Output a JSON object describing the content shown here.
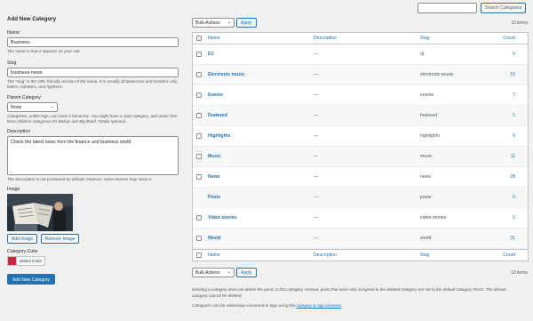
{
  "search": {
    "value": "",
    "button": "Search Categories"
  },
  "form": {
    "title": "Add New Category",
    "name_label": "Name",
    "name_value": "Business",
    "name_desc": "The name is how it appears on your site.",
    "slug_label": "Slug",
    "slug_value": "business-news",
    "slug_desc": "The “slug” is the URL-friendly version of the name. It is usually all lowercase and contains only letters, numbers, and hyphens.",
    "parent_label": "Parent Category",
    "parent_value": "None",
    "parent_desc": "Categories, unlike tags, can have a hierarchy. You might have a Jazz category, and under that have children categories for Bebop and Big Band. Totally optional.",
    "description_label": "Description",
    "description_value": "Check the latest news from the finance and business world",
    "description_desc": "The description is not prominent by default; however, some themes may show it.",
    "image_label": "Image",
    "add_image": "Add Image",
    "remove_image": "Remove Image",
    "color_label": "Category Color",
    "color_value": "#c9293f",
    "select_color": "Select Color",
    "submit": "Add New Category"
  },
  "bulk": {
    "label": "Bulk Actions",
    "apply": "Apply"
  },
  "items_count": "10 items",
  "columns": {
    "name": "Name",
    "description": "Description",
    "slug": "Slug",
    "count": "Count"
  },
  "rows": [
    {
      "name": "DJ",
      "description": "—",
      "slug": "dj",
      "count": "6"
    },
    {
      "name": "Electronic music",
      "description": "—",
      "slug": "electronic-music",
      "count": "15"
    },
    {
      "name": "Events",
      "description": "—",
      "slug": "events",
      "count": "7"
    },
    {
      "name": "Featured",
      "description": "—",
      "slug": "featured",
      "count": "5"
    },
    {
      "name": "Highlights",
      "description": "—",
      "slug": "highlights",
      "count": "6"
    },
    {
      "name": "Music",
      "description": "—",
      "slug": "music",
      "count": "11"
    },
    {
      "name": "News",
      "description": "—",
      "slug": "news",
      "count": "28"
    },
    {
      "name": "Posts",
      "description": "—",
      "slug": "posts",
      "count": "0"
    },
    {
      "name": "Video stories",
      "description": "—",
      "slug": "video-stories",
      "count": "5"
    },
    {
      "name": "World",
      "description": "—",
      "slug": "world",
      "count": "31"
    }
  ],
  "footnote1": "Deleting a category does not delete the posts in that category. Instead, posts that were only assigned to the deleted category are set to the default category Posts. The default category cannot be deleted.",
  "footnote2_pre": "Categories can be selectively converted to tags using the ",
  "footnote2_link": "category to tag converter",
  "footnote2_post": "."
}
